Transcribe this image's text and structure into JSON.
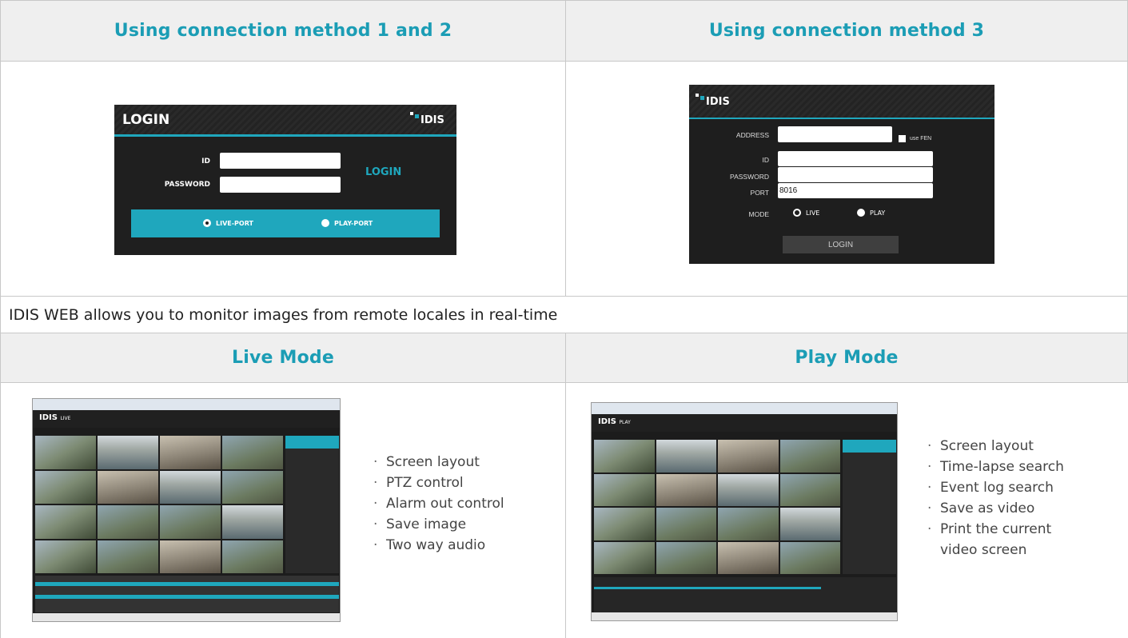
{
  "headers": {
    "method12": "Using connection method 1 and 2",
    "method3": "Using connection method 3",
    "live": "Live Mode",
    "play": "Play Mode"
  },
  "description": "IDIS WEB allows you to monitor images from remote locales in real-time",
  "login1": {
    "title": "LOGIN",
    "logo": "IDIS",
    "id_label": "ID",
    "password_label": "PASSWORD",
    "login_label": "LOGIN",
    "live_port": "LIVE-PORT",
    "play_port": "PLAY-PORT"
  },
  "login3": {
    "logo": "IDIS",
    "address_label": "ADDRESS",
    "use_fen": "use FEN",
    "id_label": "ID",
    "password_label": "PASSWORD",
    "port_label": "PORT",
    "port_value": "8016",
    "mode_label": "MODE",
    "live": "LIVE",
    "play": "PLAY",
    "login_button": "LOGIN"
  },
  "live_shot": {
    "logo": "IDIS",
    "mode": "LIVE"
  },
  "play_shot": {
    "logo": "IDIS",
    "mode": "PLAY"
  },
  "live_features": [
    "Screen layout",
    "PTZ control",
    "Alarm out control",
    "Save image",
    "Two way audio"
  ],
  "play_features": [
    "Screen layout",
    "Time-lapse search",
    "Event log search",
    "Save as video",
    "Print the current",
    "video screen"
  ],
  "colors": {
    "accent": "#1fa7bd",
    "header_bg": "#efefef",
    "border": "#c8c8c8"
  }
}
